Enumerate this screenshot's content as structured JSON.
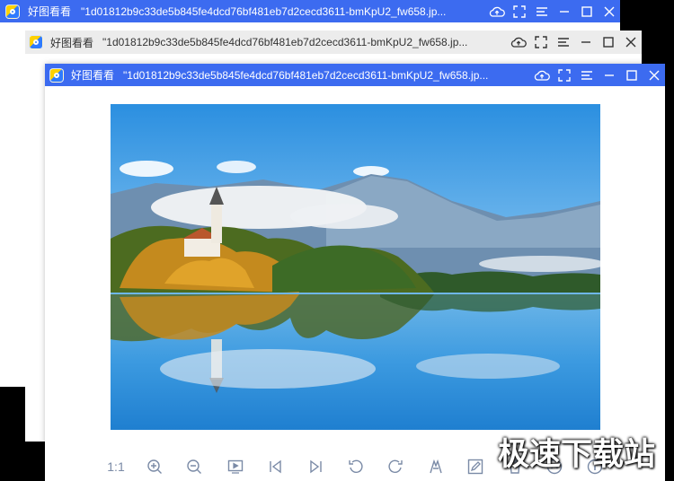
{
  "windows": [
    {
      "app_name": "好图看看",
      "file_name": "\"1d01812b9c33de5b845fe4dcd76bf481eb7d2cecd3611-bmKpU2_fw658.jp..."
    },
    {
      "app_name": "好图看看",
      "file_name": "\"1d01812b9c33de5b845fe4dcd76bf481eb7d2cecd3611-bmKpU2_fw658.jp..."
    },
    {
      "app_name": "好图看看",
      "file_name": "\"1d01812b9c33de5b845fe4dcd76bf481eb7d2cecd3611-bmKpU2_fw658.jp..."
    }
  ],
  "title_controls": [
    "cloud-upload-icon",
    "fullscreen-icon",
    "menu-icon",
    "minimize-icon",
    "maximize-icon",
    "close-icon"
  ],
  "toolbar": {
    "actual_size_label": "1:1",
    "tools": [
      "actual-size",
      "zoom-in-icon",
      "zoom-out-icon",
      "slideshow-icon",
      "previous-icon",
      "next-icon",
      "rotate-left-icon",
      "rotate-right-icon",
      "compare-icon",
      "edit-icon",
      "delete-icon",
      "up-icon",
      "info-icon"
    ]
  },
  "watermark": "极速下载站",
  "colors": {
    "titlebar_active": "#3c6bf0",
    "titlebar_inactive": "#ececec",
    "toolbar_icon": "#7a8aa6"
  }
}
